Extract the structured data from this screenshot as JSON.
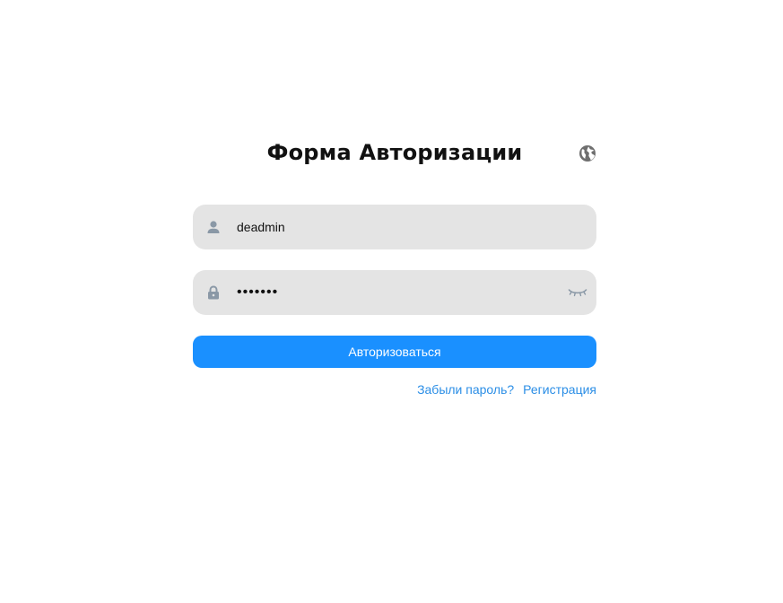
{
  "form": {
    "title": "Форма Авторизации",
    "language_icon": "globe-icon"
  },
  "login": {
    "icon": "user-icon",
    "value": "deadmin"
  },
  "password": {
    "icon": "lock-icon",
    "value": "1234567",
    "visibility_icon": "eye-closed-icon"
  },
  "actions": {
    "submit_label": "Авторизоваться",
    "forgot_label": "Забыли пароль?",
    "register_label": "Регистрация"
  },
  "colors": {
    "primary": "#1a90ff",
    "link": "#2b8ee6",
    "field_bg": "#e4e4e4",
    "icon_gray": "#8a98a6"
  }
}
